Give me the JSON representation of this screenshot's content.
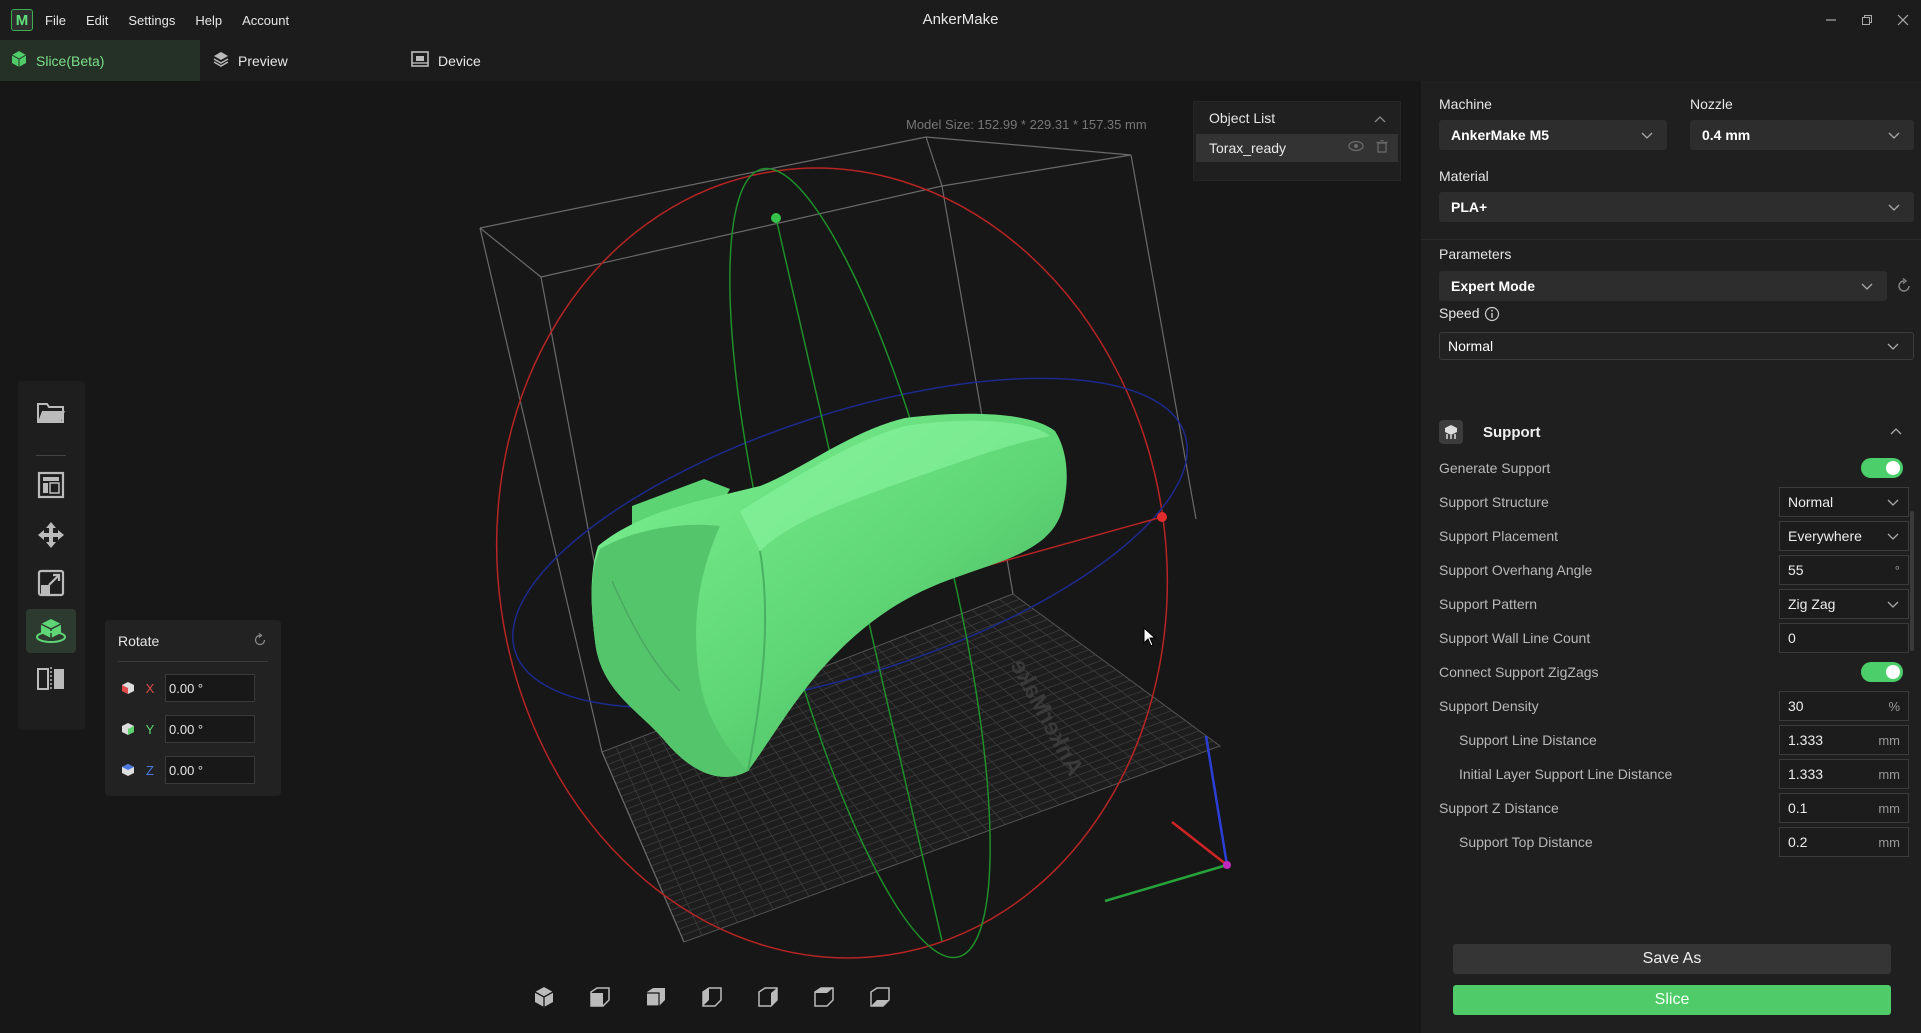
{
  "app": {
    "title": "AnkerMake",
    "logo_letter": "M",
    "menu": [
      "File",
      "Edit",
      "Settings",
      "Help",
      "Account"
    ],
    "window_controls": [
      "minimize-icon",
      "restore-icon",
      "close-icon"
    ]
  },
  "tabs": [
    {
      "label": "Slice(Beta)",
      "icon": "cube-icon",
      "active": true
    },
    {
      "label": "Preview",
      "icon": "layers-icon",
      "active": false
    },
    {
      "label": "Device",
      "icon": "printer-icon",
      "active": false
    }
  ],
  "viewport": {
    "model_size": "Model Size: 152.99 * 229.31 * 157.35 mm",
    "object_list": {
      "title": "Object List",
      "items": [
        {
          "name": "Torax_ready",
          "icons": [
            "eye-icon",
            "trash-icon"
          ]
        }
      ]
    },
    "tools": [
      "open-file-icon",
      "layout-icon",
      "move-icon",
      "scale-icon",
      "rotate-icon",
      "mirror-icon"
    ],
    "active_tool": "rotate-icon",
    "rotate_panel": {
      "title": "Rotate",
      "axes": [
        {
          "axis": "X",
          "value": "0.00 °",
          "color": "#e04a4a"
        },
        {
          "axis": "Y",
          "value": "0.00 °",
          "color": "#5cd36e"
        },
        {
          "axis": "Z",
          "value": "0.00 °",
          "color": "#4a78e0"
        }
      ]
    },
    "bed_text": "AnkerMake",
    "view_icons": [
      "iso-view-icon",
      "front-view-icon",
      "back-view-icon",
      "left-view-icon",
      "right-view-icon",
      "top-view-icon",
      "bottom-view-icon"
    ]
  },
  "panel": {
    "machine_label": "Machine",
    "machine_value": "AnkerMake M5",
    "nozzle_label": "Nozzle",
    "nozzle_value": "0.4 mm",
    "material_label": "Material",
    "material_value": "PLA+",
    "parameters_label": "Parameters",
    "parameters_value": "Expert Mode",
    "speed_label": "Speed",
    "speed_value": "Normal",
    "section_title": "Support",
    "settings": [
      {
        "label": "Generate Support",
        "type": "toggle",
        "on": true
      },
      {
        "label": "Support Structure",
        "type": "select",
        "value": "Normal"
      },
      {
        "label": "Support Placement",
        "type": "select",
        "value": "Everywhere"
      },
      {
        "label": "Support Overhang Angle",
        "type": "number",
        "value": "55",
        "unit": "°"
      },
      {
        "label": "Support Pattern",
        "type": "select",
        "value": "Zig Zag"
      },
      {
        "label": "Support Wall Line Count",
        "type": "number",
        "value": "0",
        "unit": ""
      },
      {
        "label": "Connect Support ZigZags",
        "type": "toggle",
        "on": true
      },
      {
        "label": "Support Density",
        "type": "number",
        "value": "30",
        "unit": "%"
      },
      {
        "label": "Support Line Distance",
        "type": "number",
        "value": "1.333",
        "unit": "mm",
        "sub": true
      },
      {
        "label": "Initial Layer Support Line Distance",
        "type": "number",
        "value": "1.333",
        "unit": "mm",
        "sub": true
      },
      {
        "label": "Support Z Distance",
        "type": "number",
        "value": "0.1",
        "unit": "mm"
      },
      {
        "label": "Support Top Distance",
        "type": "number",
        "value": "0.2",
        "unit": "mm",
        "sub": true
      }
    ],
    "save_as_label": "Save As",
    "slice_label": "Slice"
  },
  "colors": {
    "accent": "#4fcb6a",
    "model": "#66e07e",
    "background": "#171717",
    "panel": "#1f1f1f"
  }
}
